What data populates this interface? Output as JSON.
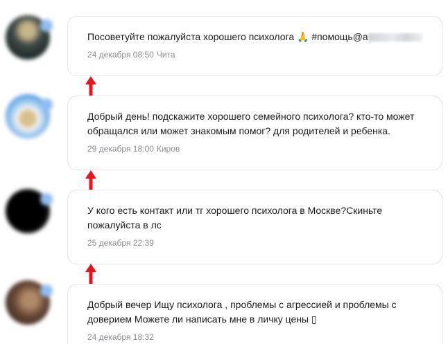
{
  "posts": [
    {
      "text": "Посоветуйте пожалуйста хорошего психолога 🙏 #помощь@а",
      "date": "24 декабря 08:50",
      "city": "Чита"
    },
    {
      "text": "Добрый день! подскажите хорошего семейного психолога? кто-то может обращался или может знакомым помог? для родителей и ребенка.",
      "date": "29 декабря 18:00",
      "city": "Киров"
    },
    {
      "text": "У кого есть контакт или тг хорошего психолога в Москве?Скиньте пожалуйста в лс",
      "date": "25 декабря 22:39",
      "city": ""
    },
    {
      "text": "Добрый вечер Ищу психолога , проблемы с агрессией и проблемы с доверием Можете ли написать мне в личку цены ▯",
      "date": "24 декабря 18:32",
      "city": ""
    }
  ],
  "colors": {
    "arrow": "#e8141b",
    "card_border": "#e3e4e8",
    "meta_text": "#8a8c91",
    "message_text": "#1a1a1a"
  },
  "icons": [
    "user-avatar-blurred",
    "online-badge",
    "red-up-arrow"
  ]
}
